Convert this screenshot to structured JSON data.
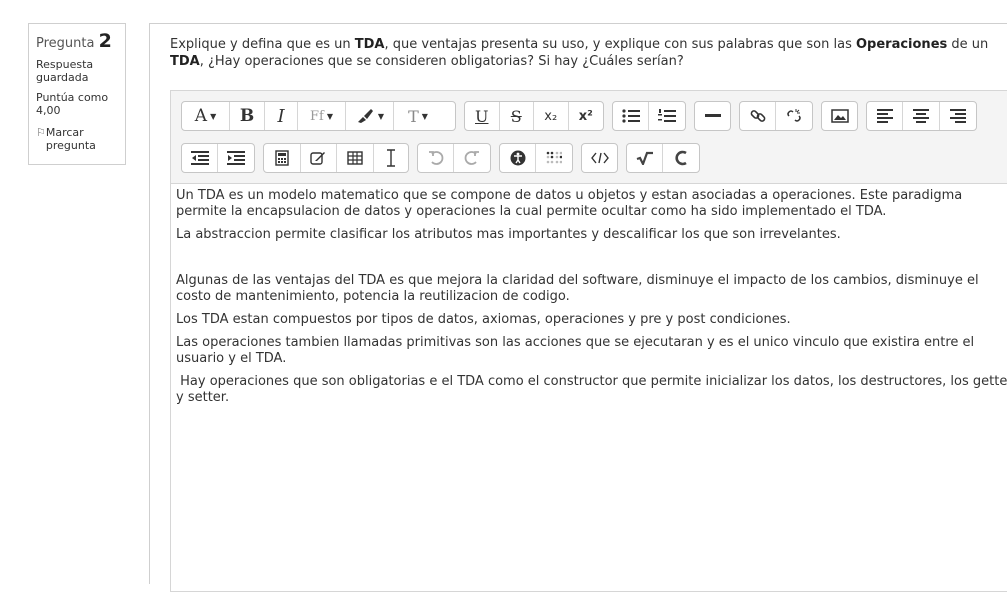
{
  "question_info": {
    "label": "Pregunta",
    "number": "2",
    "state": "Respuesta guardada",
    "grade": "Puntúa como 4,00",
    "flag_label": "Marcar pregunta"
  },
  "question": {
    "text_1": "Explique y defina que es un ",
    "bold_1": "TDA",
    "text_2": ",  que ventajas presenta su uso, y explique con sus palabras que son las ",
    "bold_2": "Operaciones",
    "text_3": " de un ",
    "bold_3": "TDA",
    "text_4": ", ¿Hay operaciones que se consideren obligatorias? Si hay ¿Cuáles serían?"
  },
  "toolbar": {
    "font_color_label": "A",
    "bold_label": "B",
    "italic_label": "I",
    "font_family_label": "Ff",
    "font_size_label": "T",
    "underline_label": "U",
    "strike_label": "S",
    "subscript_label": "x₂",
    "superscript_label": "x²"
  },
  "answer": {
    "paragraphs": [
      "Un TDA es un modelo matematico que se compone de datos u objetos y estan asociadas a operaciones. Este paradigma permite la encapsulacion de datos y operaciones la cual permite ocultar como ha sido implementado el TDA.",
      "La abstraccion permite clasificar los atributos mas importantes y descalificar los que son irrevelantes.",
      "",
      "Algunas de las ventajas del TDA es que mejora la claridad del software, disminuye el impacto de los cambios, disminuye el costo de mantenimiento, potencia la reutilizacion de codigo.",
      "Los TDA estan compuestos por tipos de datos, axiomas, operaciones y pre y post condiciones.",
      "Las operaciones tambien llamadas primitivas son las acciones que se ejecutaran y es el unico vinculo que existira entre el usuario y el TDA.",
      " Hay operaciones que son obligatorias e el TDA como el constructor que permite inicializar los datos, los destructores, los getter y setter."
    ]
  }
}
